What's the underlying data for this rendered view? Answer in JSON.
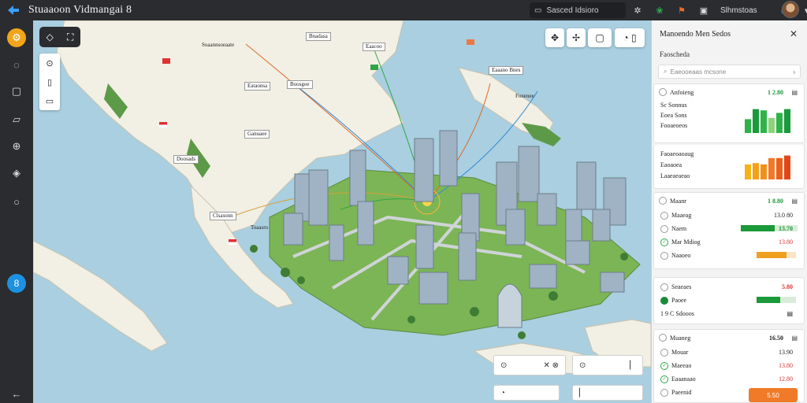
{
  "app": {
    "title": "Stuaaoon Vidmangai 8"
  },
  "topbar": {
    "search_text": "Sasced Idsioro",
    "status_label": "Slhmstoas"
  },
  "colors": {
    "accent": "#f3a519",
    "blue": "#1e90e0",
    "green": "#1a9a3a",
    "orange": "#f07a28",
    "red": "#d33"
  },
  "sidebar": {
    "icons": [
      "settings-gear-icon",
      "chat-bubble-icon",
      "document-icon",
      "comment-icon",
      "compass-icon",
      "layers-icon",
      "message-icon",
      "info-icon",
      "back-arrow-icon"
    ]
  },
  "map": {
    "labels": [
      "Bnadasa",
      "Soaannsoeaate",
      "Eaacoo",
      "Eataonsa",
      "Boosgoe",
      "Eaaano Bnes",
      "Fonenee",
      "Ganuaee",
      "Doosads",
      "Clsasonn",
      "Toaasro"
    ],
    "bottom_left_box": "",
    "bottom_mid_box": ""
  },
  "panel": {
    "title": "Manoendo Men Sedos",
    "subtitle": "Faoscheda",
    "search_placeholder": "Eaeooeaas mcsone",
    "card1": {
      "title": "Anfoieng",
      "value": "1 2.80",
      "rows": [
        "Sc Sonnus",
        "Eoea Sons",
        "Fooaeoeos"
      ],
      "bars": [
        0.55,
        0.95,
        0.9,
        0.6,
        0.8,
        0.95
      ]
    },
    "card2": {
      "rows": [
        "Faoaeoaoaug",
        "Eaoaoea",
        "Laaeaeaeao"
      ],
      "bars": [
        0.6,
        0.65,
        0.6,
        0.85,
        0.85,
        0.95
      ]
    },
    "card3": {
      "title": "Maanr",
      "value": "1 8.80",
      "rows": [
        {
          "label": "Maaeag",
          "value": "13.0 80"
        },
        {
          "label": "Naem",
          "value": "13.70",
          "fill": 0.6
        },
        {
          "label": "Mar Mdiog",
          "value": "13.80"
        },
        {
          "label": "Naaoeo",
          "value": "",
          "fill": 0.75
        }
      ]
    },
    "card4": {
      "rows": [
        {
          "label": "Seaeaes",
          "value": "5.80"
        },
        {
          "label": "Paoee",
          "value": "",
          "fill": 0.6
        },
        {
          "label": "1 9 C Sdooos",
          "value": ""
        }
      ]
    },
    "card5": {
      "title": "Muaneg",
      "value": "16.50",
      "rows": [
        {
          "label": "Mouar",
          "value": "13.90"
        },
        {
          "label": "Maeeao",
          "value": "13.80"
        },
        {
          "label": "Eaaanaao",
          "value": "12.80"
        },
        {
          "label": "Paeenid",
          "value": ""
        }
      ],
      "button": "5.50"
    }
  }
}
